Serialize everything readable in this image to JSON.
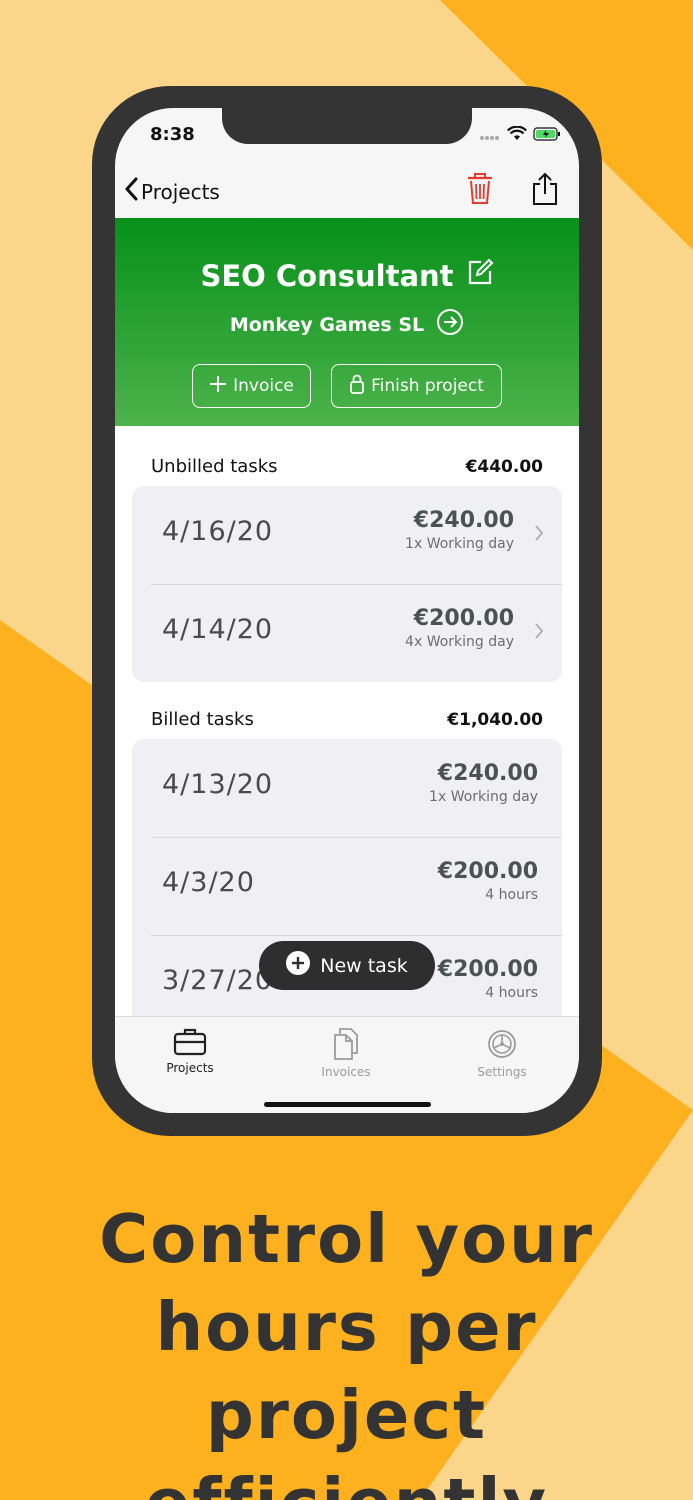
{
  "status": {
    "time": "8:38"
  },
  "nav": {
    "back_label": "Projects"
  },
  "project": {
    "title": "SEO Consultant",
    "client": "Monkey Games SL",
    "invoice_label": "Invoice",
    "finish_label": "Finish project"
  },
  "unbilled": {
    "title": "Unbilled tasks",
    "total": "€440.00",
    "rows": [
      {
        "date": "4/16/20",
        "amount": "€240.00",
        "detail": "1x Working day"
      },
      {
        "date": "4/14/20",
        "amount": "€200.00",
        "detail": "4x Working day"
      }
    ]
  },
  "billed": {
    "title": "Billed tasks",
    "total": "€1,040.00",
    "rows": [
      {
        "date": "4/13/20",
        "amount": "€240.00",
        "detail": "1x Working day"
      },
      {
        "date": "4/3/20",
        "amount": "€200.00",
        "detail": "4 hours"
      },
      {
        "date": "3/27/20",
        "amount": "€200.00",
        "detail": "4 hours"
      }
    ]
  },
  "fab": {
    "label": "New task"
  },
  "tabs": [
    {
      "label": "Projects",
      "icon": "briefcase-icon",
      "active": true
    },
    {
      "label": "Invoices",
      "icon": "documents-icon",
      "active": false
    },
    {
      "label": "Settings",
      "icon": "gear-icon",
      "active": false
    }
  ],
  "headline": {
    "line1": "Control your",
    "line2": "hours per",
    "line3": "project efficiently"
  },
  "colors": {
    "accent_green": "#06901A",
    "background_orange": "#FDB11F",
    "background_light": "#FBD68A",
    "trash_red": "#E8392E"
  }
}
